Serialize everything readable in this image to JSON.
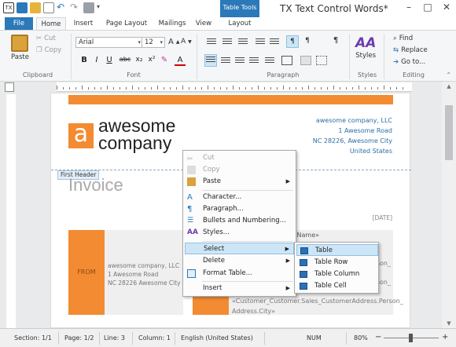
{
  "window": {
    "title": "TX Text Control Words*",
    "context_tab_group": "Table Tools",
    "controls": [
      "–",
      "□",
      "✕"
    ]
  },
  "tabs": [
    "File",
    "Home",
    "Insert",
    "Page Layout",
    "Mailings",
    "View",
    "Layout"
  ],
  "active_tab": "Home",
  "ribbon": {
    "clipboard": {
      "label": "Clipboard",
      "paste": "Paste",
      "cut": "Cut",
      "copy": "Copy"
    },
    "font": {
      "label": "Font",
      "family": "Arial",
      "size": "12",
      "bold": "B",
      "italic": "I",
      "underline": "U",
      "strike": "abc",
      "sub": "x₂",
      "sup": "x²",
      "font_color": "A"
    },
    "paragraph": {
      "label": "Paragraph"
    },
    "styles": {
      "label": "Styles",
      "styles_button": "Styles"
    },
    "editing": {
      "label": "Editing",
      "find": "Find",
      "replace": "Replace",
      "goto": "Go to..."
    }
  },
  "document": {
    "logo_letter": "a",
    "logo_line1": "awesome",
    "logo_line2": "company",
    "address": [
      "awesome company, LLC",
      "1 Awesome Road",
      "NC 28226, Awesome City",
      "United States"
    ],
    "header_tag": "First Header",
    "invoice_title": "Invoice",
    "date_placeholder": "[DATE]",
    "from_label": "FROM",
    "from_address": [
      "awesome company, LLC",
      "1 Awesome Road",
      "NC 28226 Awesome City"
    ],
    "to_name_fragment": ".Name»",
    "to_fragment_1": "_Person_",
    "to_fragment_2": "_Person_",
    "to_merge_lines": [
      "«Customer_Customer.Sales_CustomerAddress.Person_",
      "Address.City»"
    ]
  },
  "context_menu": {
    "items": [
      {
        "label": "Cut",
        "enabled": false,
        "icon": "cut-icon"
      },
      {
        "label": "Copy",
        "enabled": false,
        "icon": "copy-icon"
      },
      {
        "label": "Paste",
        "enabled": true,
        "icon": "paste-icon",
        "submenu": true
      },
      {
        "label": "Character...",
        "enabled": true,
        "icon": "character-icon"
      },
      {
        "label": "Paragraph...",
        "enabled": true,
        "icon": "paragraph-icon"
      },
      {
        "label": "Bullets and Numbering...",
        "enabled": true,
        "icon": "bullets-icon"
      },
      {
        "label": "Styles...",
        "enabled": true,
        "icon": "styles-icon"
      },
      {
        "label": "Select",
        "enabled": true,
        "highlighted": true,
        "submenu": true
      },
      {
        "label": "Delete",
        "enabled": true,
        "submenu": true
      },
      {
        "label": "Format Table...",
        "enabled": true,
        "icon": "format-table-icon"
      },
      {
        "label": "Insert",
        "enabled": true,
        "submenu": true
      }
    ],
    "select_submenu": [
      "Table",
      "Table Row",
      "Table Column",
      "Table Cell"
    ]
  },
  "statusbar": {
    "section": "Section: 1/1",
    "page": "Page: 1/2",
    "line": "Line: 3",
    "column": "Column: 1",
    "language": "English (United States)",
    "num": "NUM",
    "zoom": "80%",
    "zoom_minus": "−",
    "zoom_plus": "+"
  },
  "colors": {
    "accent": "#2b79b8",
    "brand_orange": "#f38b32",
    "address_blue": "#2c6ea6",
    "menu_highlight": "#cde6f7"
  }
}
